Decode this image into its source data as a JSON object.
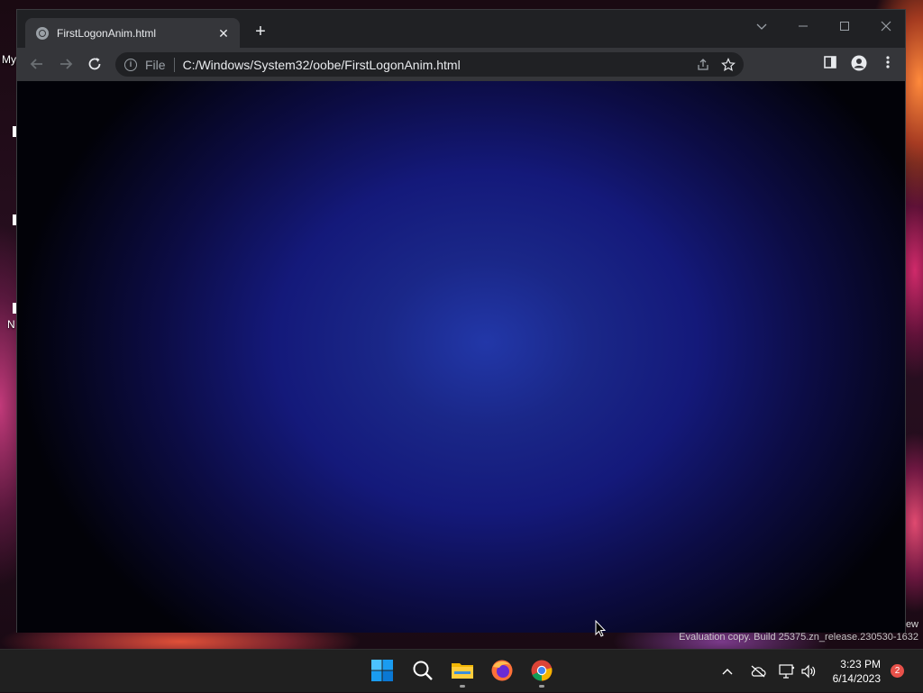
{
  "desktop": {
    "labels": [
      "My",
      "N"
    ]
  },
  "browser": {
    "tab": {
      "title": "FirstLogonAnim.html",
      "close": "✕"
    },
    "new_tab": "+",
    "omnibox": {
      "info": "i",
      "scheme": "File",
      "url": "C:/Windows/System32/oobe/FirstLogonAnim.html"
    },
    "page": {
      "background_center": "#2237a8",
      "background_edge": "#020208"
    }
  },
  "watermark": {
    "text": "Evaluation copy. Build 25375.zn_release.230530-1632",
    "fragment": "ew"
  },
  "taskbar": {
    "apps": [
      "windows-start",
      "search",
      "file-explorer",
      "firefox",
      "chrome"
    ],
    "clock": {
      "time": "3:23 PM",
      "date": "6/14/2023"
    },
    "notification_count": "2"
  },
  "colors": {
    "accent_blue": "#0a84ff",
    "badge": "#e8514a",
    "window_bg": "#202124",
    "toolbar_bg": "#35363a"
  }
}
